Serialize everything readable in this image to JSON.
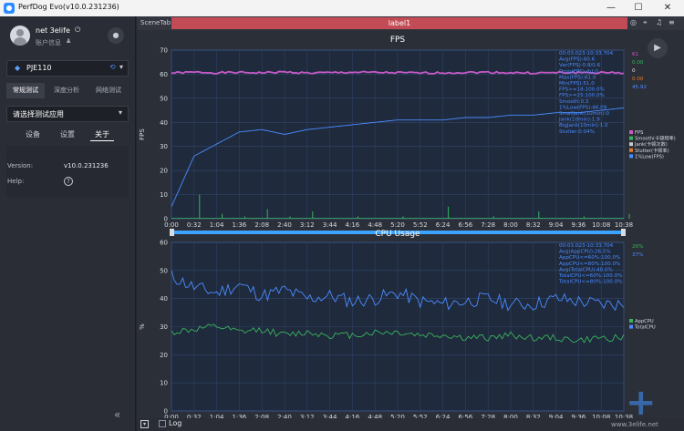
{
  "window": {
    "title": "PerfDog Evo(v10.0.231236)",
    "controls": [
      "—",
      "☐",
      "✕"
    ]
  },
  "sidebar": {
    "user_name": "net 3elife",
    "account_info": "账户信息",
    "device": "PJE110",
    "tabs": [
      "常规测试",
      "深度分析",
      "网络测试"
    ],
    "active_tab": 0,
    "app_placeholder": "请选择测试应用",
    "subtabs": [
      "设备",
      "设置",
      "关于"
    ],
    "active_subtab": 2,
    "info": {
      "version_label": "Version:",
      "version_value": "v10.0.231236",
      "help_label": "Help:"
    },
    "collapse_icon": "«"
  },
  "main": {
    "scene_tab": "SceneTab",
    "label": "label1",
    "top_icons": [
      "pin-icon",
      "location-icon",
      "bell-icon",
      "menu-icon"
    ],
    "bottom": {
      "log_label": "Log"
    },
    "watermark": {
      "symbol": "+",
      "url": "www.3elife.net"
    }
  },
  "chart_data": [
    {
      "type": "line",
      "title": "FPS",
      "ylabel": "FPS",
      "xlabel": "",
      "ylim": [
        0,
        70
      ],
      "yticks": [
        0,
        10,
        20,
        30,
        40,
        50,
        60,
        70
      ],
      "xticks": [
        "0:00",
        "0:32",
        "1:04",
        "1:36",
        "2:08",
        "2:40",
        "3:12",
        "3:44",
        "4:16",
        "4:48",
        "5:20",
        "5:52",
        "6:24",
        "6:56",
        "7:28",
        "8:00",
        "8:32",
        "9:04",
        "9:36",
        "10:08",
        "10:38"
      ],
      "grid": true,
      "stats": [
        "00:03.023-10:33.704",
        "Avg(FPS):60.6",
        "Var(FPS):0.8/0.6",
        "Drop(FPS):/h]:0",
        "Max(FPS):61.0",
        "Min(FPS):51.0",
        "FPS>=18:100.0%",
        "FPS>=25:100.0%",
        "Smooth:0.3",
        "1%Low(FPS):46.09",
        "SmallJank(10min):0",
        "Jank(10min):1.9",
        "BigJank(10min):1.0",
        "Stutter:0.04%"
      ],
      "stats_right": [
        {
          "value": "61",
          "color": "#c65ac6"
        },
        {
          "value": "0.00",
          "color": "#39b35d"
        },
        {
          "value": "0",
          "color": "#e0e0e0"
        },
        {
          "value": "0.00",
          "color": "#e07830"
        },
        {
          "value": "45.92",
          "color": "#4a8cff"
        }
      ],
      "legend": [
        {
          "name": "FPS",
          "color": "#c65ac6"
        },
        {
          "name": "Smooth(卡顿频率)",
          "color": "#39b35d"
        },
        {
          "name": "Jank(卡顿次数)",
          "color": "#c8c8c8"
        },
        {
          "name": "Stutter(卡顿率)",
          "color": "#e07830"
        },
        {
          "name": "1%Low(FPS)",
          "color": "#4a8cff"
        }
      ],
      "legend_position": "right",
      "series": [
        {
          "name": "FPS",
          "values": [
            60.5,
            60.8,
            60.6,
            60.7,
            60.6,
            60.9,
            60.5,
            60.6,
            60.8,
            60.7,
            60.6,
            60.5,
            60.6,
            60.7,
            60.8,
            60.6,
            60.5,
            60.6,
            60.7,
            60.6,
            60.6
          ]
        },
        {
          "name": "1%Low(FPS)",
          "values": [
            5,
            26,
            31,
            36,
            37,
            35,
            37,
            38,
            39,
            40,
            41,
            41,
            41,
            42,
            42,
            43,
            43,
            44,
            44,
            45,
            46
          ]
        },
        {
          "name": "Smooth(卡顿频率)",
          "values": [
            0,
            10,
            2,
            1,
            4,
            1,
            3,
            0,
            1,
            0,
            1,
            0,
            5,
            0,
            1,
            0,
            3,
            0,
            1,
            0,
            2
          ]
        }
      ]
    },
    {
      "type": "line",
      "title": "CPU Usage",
      "ylabel": "%",
      "xlabel": "",
      "ylim": [
        0,
        60
      ],
      "yticks": [
        0,
        10,
        20,
        30,
        40,
        50,
        60
      ],
      "xticks": [
        "0:00",
        "0:32",
        "1:04",
        "1:36",
        "2:08",
        "2:40",
        "3:12",
        "3:44",
        "4:16",
        "4:48",
        "5:20",
        "5:52",
        "6:24",
        "6:56",
        "7:28",
        "8:00",
        "8:32",
        "9:04",
        "9:36",
        "10:08",
        "10:38"
      ],
      "grid": true,
      "stats": [
        "00:03.023-10:33.704",
        "Avg(AppCPU):26.5%",
        "AppCPU<=60%:100.0%",
        "AppCPU<=80%:100.0%",
        "Avg(TotalCPU):40.0%",
        "TotalCPU<=60%:100.0%",
        "TotalCPU<=80%:100.0%"
      ],
      "stats_right": [
        {
          "value": "26%",
          "color": "#39b35d"
        },
        {
          "value": "37%",
          "color": "#4a8cff"
        }
      ],
      "legend": [
        {
          "name": "AppCPU",
          "color": "#39b35d"
        },
        {
          "name": "TotalCPU",
          "color": "#4a8cff"
        }
      ],
      "legend_position": "right",
      "series": [
        {
          "name": "TotalCPU",
          "values": [
            48,
            44,
            42,
            45,
            41,
            43,
            40,
            41,
            39,
            40,
            42,
            39,
            38,
            39,
            40,
            38,
            38,
            40,
            39,
            38,
            38
          ]
        },
        {
          "name": "AppCPU",
          "values": [
            28,
            29,
            30,
            28,
            29,
            27,
            28,
            27,
            27,
            28,
            28,
            27,
            27,
            26,
            26,
            27,
            26,
            26,
            25,
            26,
            26
          ]
        }
      ]
    }
  ]
}
